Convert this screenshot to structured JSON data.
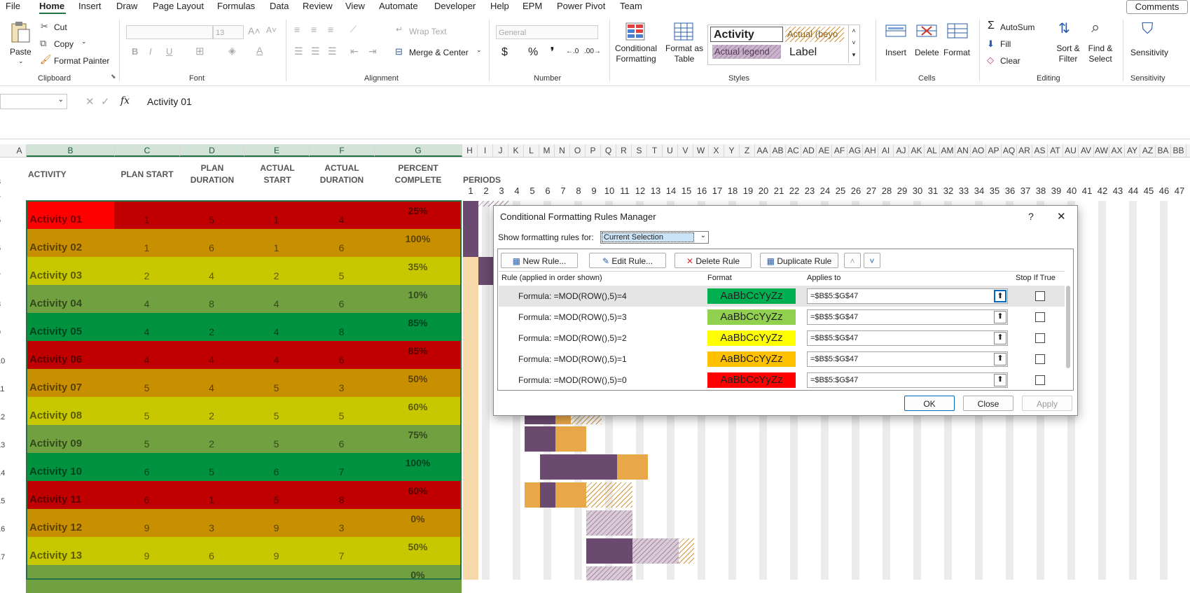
{
  "menu": [
    "File",
    "Home",
    "Insert",
    "Draw",
    "Page Layout",
    "Formulas",
    "Data",
    "Review",
    "View",
    "Automate",
    "Developer",
    "Help",
    "EPM",
    "Power Pivot",
    "Team"
  ],
  "menu_active": "Home",
  "comments_label": "Comments",
  "ribbon": {
    "clipboard": {
      "paste": "Paste",
      "cut": "Cut",
      "copy": "Copy",
      "format_painter": "Format Painter",
      "label": "Clipboard"
    },
    "font": {
      "size": "13",
      "label": "Font"
    },
    "alignment": {
      "wrap_text": "Wrap Text",
      "merge_center": "Merge & Center",
      "label": "Alignment"
    },
    "number": {
      "format": "General",
      "label": "Number"
    },
    "styles": {
      "conditional_formatting": "Conditional Formatting",
      "format_as_table": "Format as Table",
      "style_activity": "Activity",
      "style_actual_beyond": "Actual (beyo",
      "style_actual_legend": "Actual legend",
      "style_label": "Label",
      "label": "Styles"
    },
    "cells": {
      "insert": "Insert",
      "delete": "Delete",
      "format": "Format",
      "label": "Cells"
    },
    "editing": {
      "autosum": "AutoSum",
      "fill": "Fill",
      "clear": "Clear",
      "sort_filter": "Sort & Filter",
      "find_select": "Find & Select",
      "label": "Editing"
    },
    "sensitivity": {
      "sensitivity": "Sensitivity",
      "label": "Sensitivity"
    }
  },
  "formula_bar": {
    "fx": "fx",
    "value": "Activity 01"
  },
  "columns": [
    "A",
    "B",
    "C",
    "D",
    "E",
    "F",
    "G",
    "H",
    "I",
    "J",
    "K",
    "L",
    "M",
    "N",
    "O",
    "P",
    "Q",
    "R",
    "S",
    "T",
    "U",
    "V",
    "W",
    "X",
    "Y",
    "Z",
    "AA",
    "AB",
    "AC",
    "AD",
    "AE",
    "AF",
    "AG",
    "AH",
    "AI",
    "AJ",
    "AK",
    "AL",
    "AM",
    "AN",
    "AO",
    "AP",
    "AQ",
    "AR",
    "AS",
    "AT",
    "AU",
    "AV",
    "AW",
    "AX",
    "AY",
    "AZ",
    "BA",
    "BB"
  ],
  "row_numbers": [
    "3",
    "4",
    "5",
    "6",
    "7",
    "8",
    "9",
    "10",
    "11",
    "12",
    "13",
    "14",
    "15",
    "16",
    "17"
  ],
  "headers": {
    "activity": "ACTIVITY",
    "plan_start": "PLAN START",
    "plan_duration": "PLAN DURATION",
    "actual_start": "ACTUAL START",
    "actual_duration": "ACTUAL DURATION",
    "percent_complete": "PERCENT COMPLETE",
    "periods": "PERIODS"
  },
  "periods": [
    "1",
    "2",
    "3",
    "4",
    "5",
    "6",
    "7",
    "8",
    "9",
    "10",
    "11",
    "12",
    "13",
    "14",
    "15",
    "16",
    "17",
    "18",
    "19",
    "20",
    "21",
    "22",
    "23",
    "24",
    "25",
    "26",
    "27",
    "28",
    "29",
    "30",
    "31",
    "32",
    "33",
    "34",
    "35",
    "36",
    "37",
    "38",
    "39",
    "40",
    "41",
    "42",
    "43",
    "44",
    "45",
    "46",
    "47"
  ],
  "activities": [
    {
      "name": "Activity 01",
      "plan_start": "1",
      "plan_duration": "5",
      "actual_start": "1",
      "actual_duration": "4",
      "percent": "25%",
      "color": "#c00000"
    },
    {
      "name": "Activity 02",
      "plan_start": "1",
      "plan_duration": "6",
      "actual_start": "1",
      "actual_duration": "6",
      "percent": "100%",
      "color": "#c89000"
    },
    {
      "name": "Activity 03",
      "plan_start": "2",
      "plan_duration": "4",
      "actual_start": "2",
      "actual_duration": "5",
      "percent": "35%",
      "color": "#c8c800"
    },
    {
      "name": "Activity 04",
      "plan_start": "4",
      "plan_duration": "8",
      "actual_start": "4",
      "actual_duration": "6",
      "percent": "10%",
      "color": "#70a040"
    },
    {
      "name": "Activity 05",
      "plan_start": "4",
      "plan_duration": "2",
      "actual_start": "4",
      "actual_duration": "8",
      "percent": "85%",
      "color": "#00923f"
    },
    {
      "name": "Activity 06",
      "plan_start": "4",
      "plan_duration": "4",
      "actual_start": "4",
      "actual_duration": "6",
      "percent": "85%",
      "color": "#c00000"
    },
    {
      "name": "Activity 07",
      "plan_start": "5",
      "plan_duration": "4",
      "actual_start": "5",
      "actual_duration": "3",
      "percent": "50%",
      "color": "#c89000"
    },
    {
      "name": "Activity 08",
      "plan_start": "5",
      "plan_duration": "2",
      "actual_start": "5",
      "actual_duration": "5",
      "percent": "60%",
      "color": "#c8c800"
    },
    {
      "name": "Activity 09",
      "plan_start": "5",
      "plan_duration": "2",
      "actual_start": "5",
      "actual_duration": "6",
      "percent": "75%",
      "color": "#70a040"
    },
    {
      "name": "Activity 10",
      "plan_start": "6",
      "plan_duration": "5",
      "actual_start": "6",
      "actual_duration": "7",
      "percent": "100%",
      "color": "#00923f"
    },
    {
      "name": "Activity 11",
      "plan_start": "6",
      "plan_duration": "1",
      "actual_start": "5",
      "actual_duration": "8",
      "percent": "60%",
      "color": "#c00000"
    },
    {
      "name": "Activity 12",
      "plan_start": "9",
      "plan_duration": "3",
      "actual_start": "9",
      "actual_duration": "3",
      "percent": "0%",
      "color": "#c89000"
    },
    {
      "name": "Activity 13",
      "plan_start": "9",
      "plan_duration": "6",
      "actual_start": "9",
      "actual_duration": "7",
      "percent": "50%",
      "color": "#c8c800"
    },
    {
      "name": "",
      "plan_start": "",
      "plan_duration": "",
      "actual_start": "",
      "actual_duration": "",
      "percent": "0%",
      "color": "#70a040"
    }
  ],
  "dialog": {
    "title": "Conditional Formatting Rules Manager",
    "help": "?",
    "close": "✕",
    "show_rules_label": "Show formatting rules for:",
    "show_rules_value": "Current Selection",
    "new_rule": "New Rule...",
    "edit_rule": "Edit Rule...",
    "delete_rule": "Delete Rule",
    "duplicate_rule": "Duplicate Rule",
    "col_rule": "Rule (applied in order shown)",
    "col_format": "Format",
    "col_applies": "Applies to",
    "col_stop": "Stop If True",
    "preview_text": "AaBbCcYyZz",
    "rules": [
      {
        "rule": "Formula: =MOD(ROW(),5)=4",
        "applies": "=$B$5:$G$47",
        "color": "#00b050",
        "stop": false
      },
      {
        "rule": "Formula: =MOD(ROW(),5)=3",
        "applies": "=$B$5:$G$47",
        "color": "#92d050",
        "stop": false
      },
      {
        "rule": "Formula: =MOD(ROW(),5)=2",
        "applies": "=$B$5:$G$47",
        "color": "#ffff00",
        "stop": false
      },
      {
        "rule": "Formula: =MOD(ROW(),5)=1",
        "applies": "=$B$5:$G$47",
        "color": "#ffc000",
        "stop": false
      },
      {
        "rule": "Formula: =MOD(ROW(),5)=0",
        "applies": "=$B$5:$G$47",
        "color": "#ff0000",
        "stop": false
      }
    ],
    "ok": "OK",
    "close_btn": "Close",
    "apply": "Apply"
  }
}
